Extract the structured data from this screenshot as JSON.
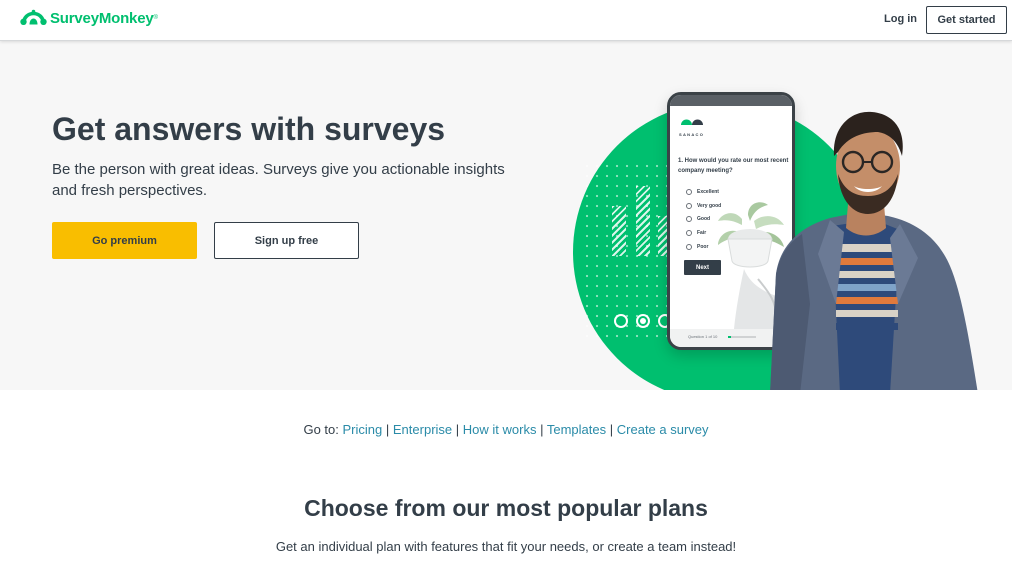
{
  "header": {
    "logo_text": "SurveyMonkey",
    "logo_tm": "®",
    "login_label": "Log in",
    "get_started_label": "Get started"
  },
  "hero": {
    "title": "Get answers with surveys",
    "subtitle": "Be the person with great ideas. Surveys give you actionable insights and fresh perspectives.",
    "primary_button": "Go premium",
    "secondary_button": "Sign up free"
  },
  "phone": {
    "brand": "SANACO",
    "question": "1. How would you rate our most recent company meeting?",
    "options": [
      "Excellent",
      "Very good",
      "Good",
      "Fair",
      "Poor"
    ],
    "next_label": "Next",
    "question_counter": "Question 1 of 10",
    "progress": 0.1
  },
  "goto": {
    "prefix": "Go to:",
    "links": [
      "Pricing",
      "Enterprise",
      "How it works",
      "Templates",
      "Create a survey"
    ],
    "separator": "|"
  },
  "plans": {
    "title": "Choose from our most popular plans",
    "subtitle": "Get an individual plan with features that fit your needs, or create a team instead!"
  },
  "colors": {
    "brand_green": "#00bf6f",
    "premium_yellow": "#f9be00",
    "text_dark": "#333e48",
    "link_blue": "#2a8ba8",
    "hero_bg": "#f7f7f7"
  },
  "icons": {
    "logo": "surveymonkey-logo-icon"
  }
}
